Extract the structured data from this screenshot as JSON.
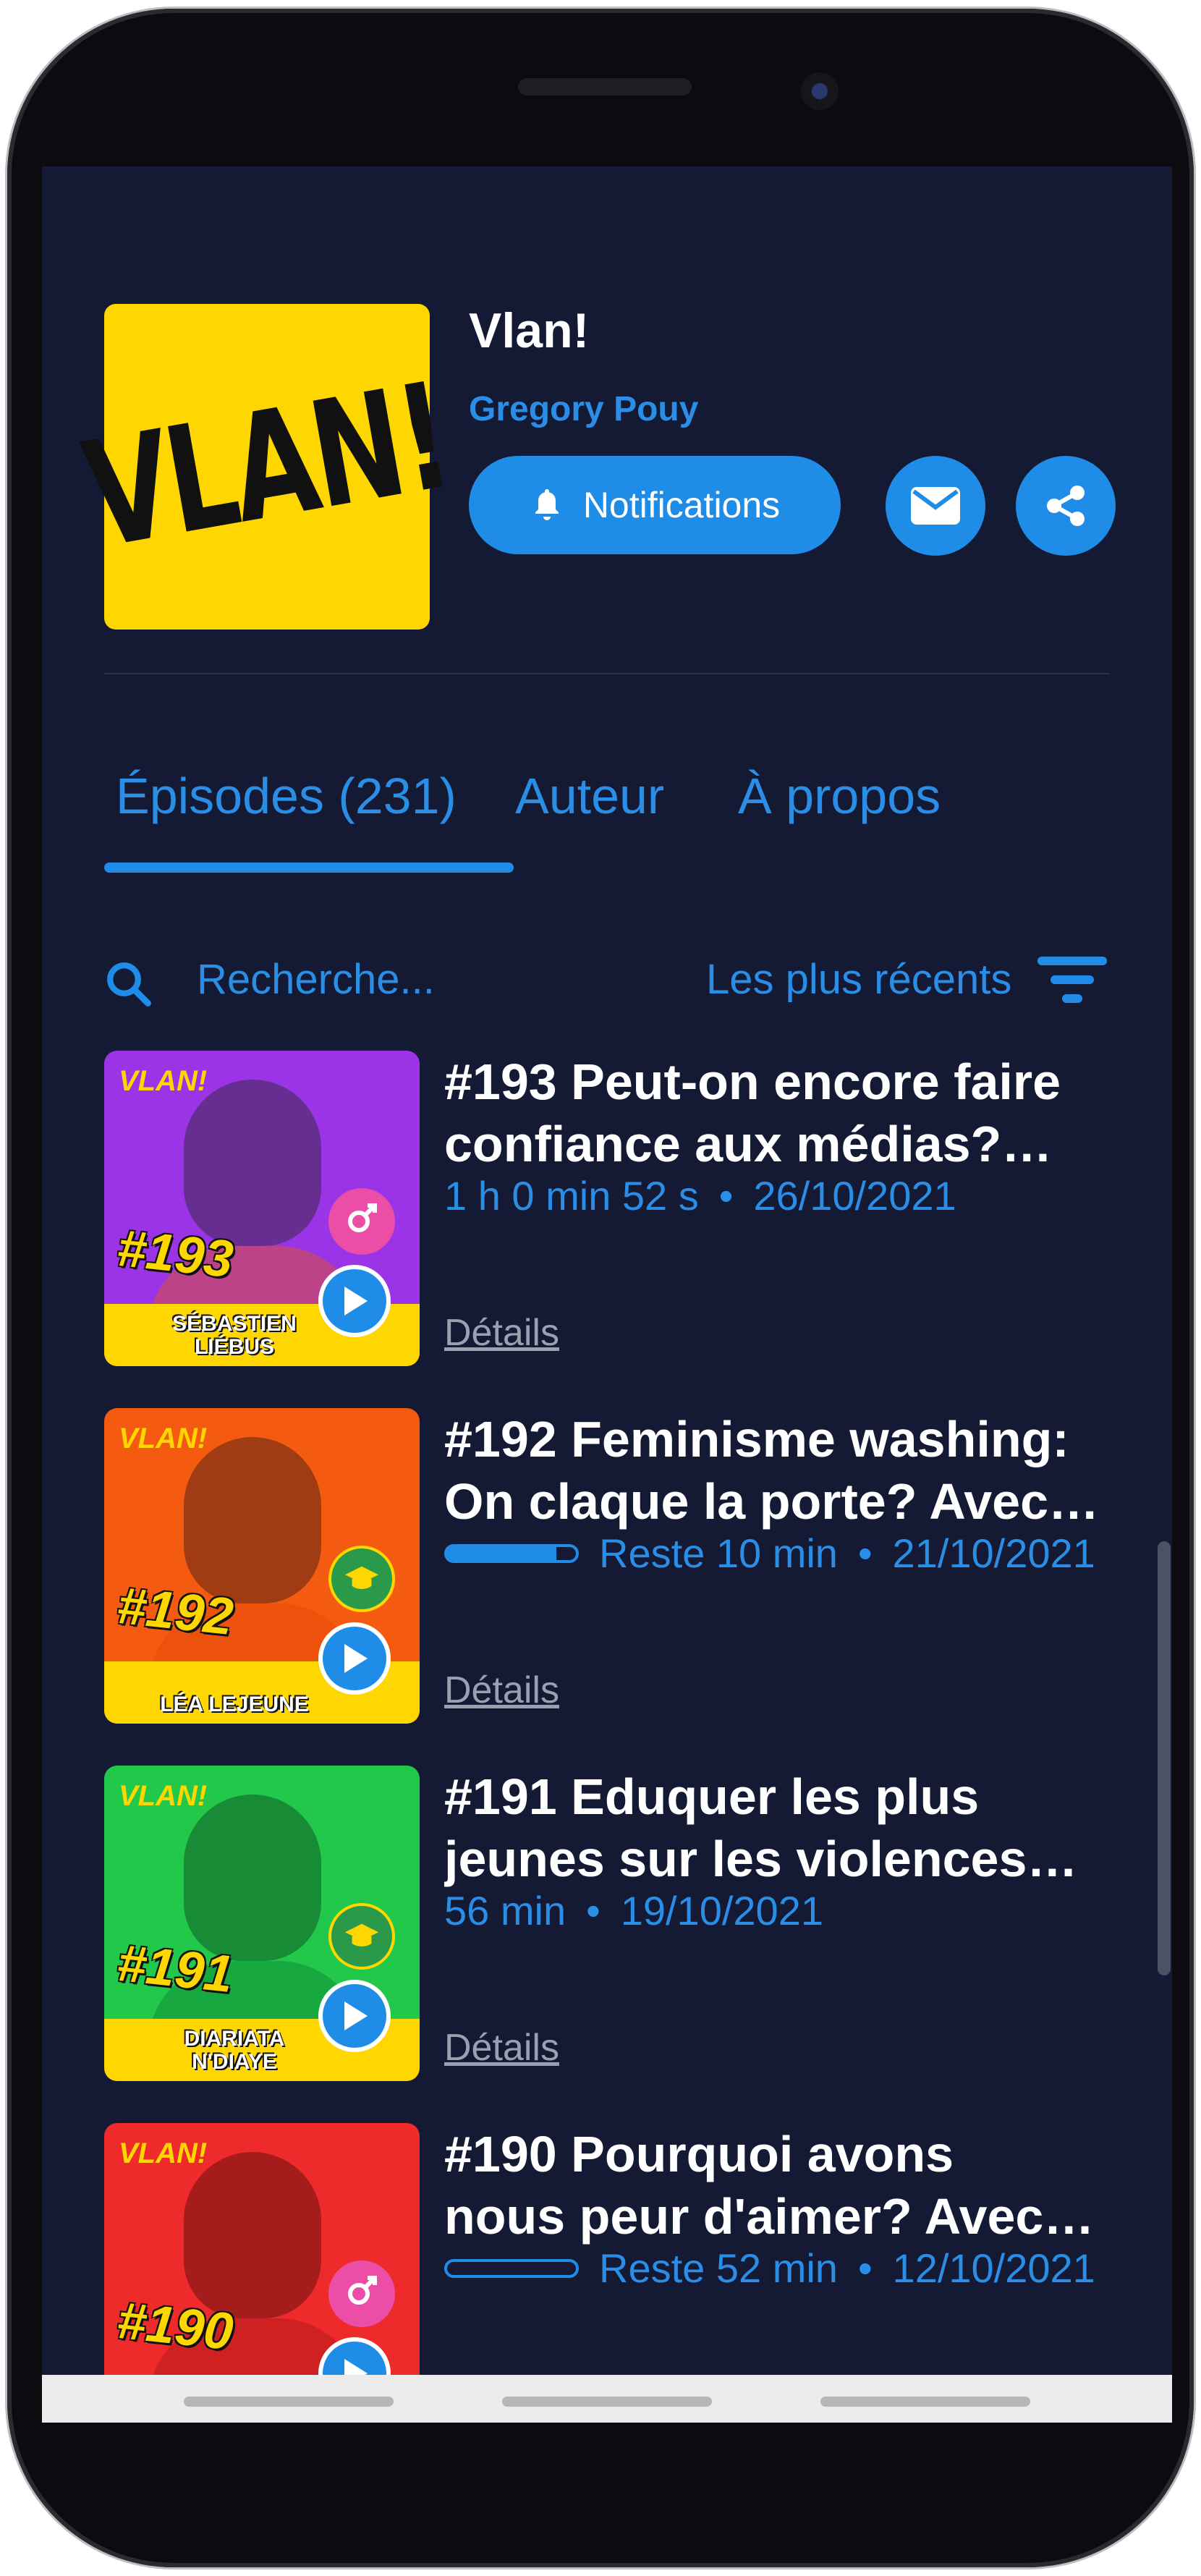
{
  "header": {
    "cover_text": "VLAN!",
    "title": "Vlan!",
    "author": "Gregory Pouy",
    "notifications_label": "Notifications"
  },
  "tabs": [
    {
      "label": "Épisodes (231)",
      "active": true
    },
    {
      "label": "Auteur",
      "active": false
    },
    {
      "label": "À propos",
      "active": false
    }
  ],
  "search": {
    "placeholder": "Recherche..."
  },
  "sort": {
    "label": "Les plus récents"
  },
  "episodes": [
    {
      "title_line1": "#193 Peut-on encore faire",
      "title_line2": "confiance aux médias?…",
      "duration": "1 h 0 min 52 s",
      "date": "26/10/2021",
      "details": "Détails",
      "thumb_brand": "VLAN!",
      "thumb_number": "#193",
      "thumb_guest": "SÉBASTIEN LIÉBUS",
      "thumb_color": "#9b34e6"
    },
    {
      "title_line1": "#192 Feminisme washing:",
      "title_line2": "On claque la porte? Avec…",
      "remaining": "Reste 10 min",
      "date": "21/10/2021",
      "progress": 0.85,
      "details": "Détails",
      "thumb_brand": "VLAN!",
      "thumb_number": "#192",
      "thumb_guest": "LÉA LEJEUNE",
      "thumb_color": "#f45a10"
    },
    {
      "title_line1": "#191 Eduquer les plus",
      "title_line2": "jeunes sur les violences…",
      "duration": "56 min",
      "date": "19/10/2021",
      "details": "Détails",
      "thumb_brand": "VLAN!",
      "thumb_number": "#191",
      "thumb_guest": "DIARIATA N'DIAYE",
      "thumb_color": "#22c84a"
    },
    {
      "title_line1": "#190 Pourquoi avons",
      "title_line2": "nous peur d'aimer? Avec…",
      "remaining": "Reste 52 min",
      "date": "12/10/2021",
      "progress": 0.0,
      "thumb_brand": "VLAN!",
      "thumb_number": "#190",
      "thumb_color": "#ee2a2a"
    }
  ],
  "colors": {
    "background": "#141a33",
    "accent": "#1f8de8",
    "cover_yellow": "#fed600"
  }
}
